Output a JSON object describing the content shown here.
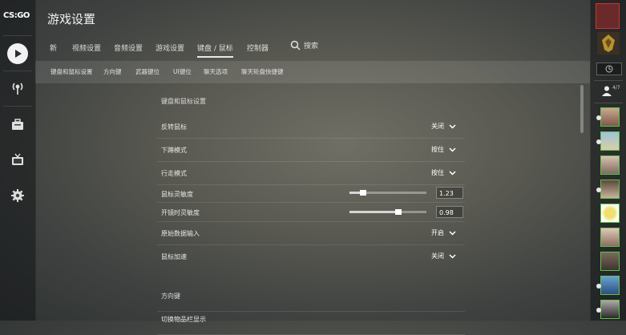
{
  "app": {
    "logo_text": "CS:GO",
    "page_title": "游戏设置"
  },
  "nav": {
    "tabs": [
      {
        "label": "新"
      },
      {
        "label": "视频设置"
      },
      {
        "label": "音频设置"
      },
      {
        "label": "游戏设置"
      },
      {
        "label": "键盘 / 鼠标"
      },
      {
        "label": "控制器"
      }
    ],
    "active_tab": "键盘 / 鼠标",
    "search_label": "搜索"
  },
  "subnav": {
    "items": [
      {
        "label": "键盘和鼠标设置"
      },
      {
        "label": "方向键"
      },
      {
        "label": "武器键位"
      },
      {
        "label": "UI键位"
      },
      {
        "label": "聊天选项"
      },
      {
        "label": "聊天轮盘快捷键"
      }
    ]
  },
  "settings": {
    "section_title": "键盘和鼠标设置",
    "rows": [
      {
        "label": "反转鼠标",
        "value": "关闭"
      },
      {
        "label": "下蹲模式",
        "value": "按住"
      },
      {
        "label": "行走模式",
        "value": "按住"
      },
      {
        "label": "鼠标灵敏度",
        "value": "1.23",
        "slider_fraction": 0.18
      },
      {
        "label": "开镜时灵敏度",
        "value": "0.98",
        "slider_fraction": 0.64
      },
      {
        "label": "原始数据输入",
        "value": "开启"
      },
      {
        "label": "鼠标加速",
        "value": "关闭"
      }
    ],
    "section2_title": "方向键",
    "section2_first_row": "切换物品栏显示"
  },
  "friends": {
    "count_label": "4/7"
  },
  "colors": {
    "accent": "#5cc24a",
    "text": "#e6e6e6"
  }
}
